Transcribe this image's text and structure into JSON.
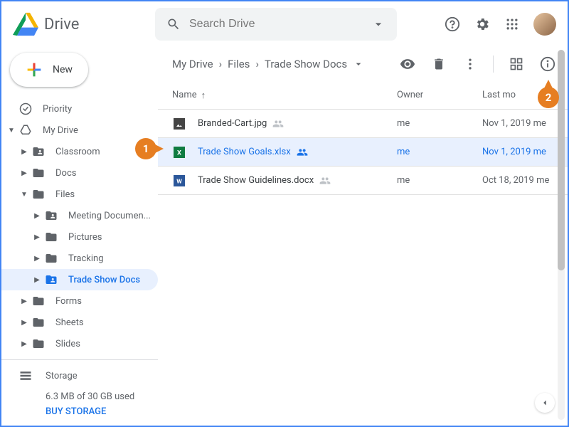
{
  "header": {
    "app_name": "Drive",
    "search_placeholder": "Search Drive"
  },
  "sidebar": {
    "new_label": "New",
    "items": [
      {
        "label": "Priority"
      },
      {
        "label": "My Drive"
      },
      {
        "label": "Classroom"
      },
      {
        "label": "Docs"
      },
      {
        "label": "Files"
      },
      {
        "label": "Meeting Documen..."
      },
      {
        "label": "Pictures"
      },
      {
        "label": "Tracking"
      },
      {
        "label": "Trade Show Docs"
      },
      {
        "label": "Forms"
      },
      {
        "label": "Sheets"
      },
      {
        "label": "Slides"
      }
    ],
    "storage_label": "Storage",
    "storage_used": "6.3 MB of 30 GB used",
    "buy_label": "BUY STORAGE"
  },
  "breadcrumb": {
    "items": [
      "My Drive",
      "Files",
      "Trade Show Docs"
    ]
  },
  "columns": {
    "name": "Name",
    "owner": "Owner",
    "modified": "Last mo"
  },
  "files": [
    {
      "name": "Branded-Cart.jpg",
      "owner": "me",
      "modified": "Nov 1, 2019 me"
    },
    {
      "name": "Trade Show Goals.xlsx",
      "owner": "me",
      "modified": "Nov 1, 2019 me"
    },
    {
      "name": "Trade Show Guidelines.docx",
      "owner": "me",
      "modified": "Oct 18, 2019 me"
    }
  ],
  "callouts": {
    "c1": "1",
    "c2": "2"
  }
}
